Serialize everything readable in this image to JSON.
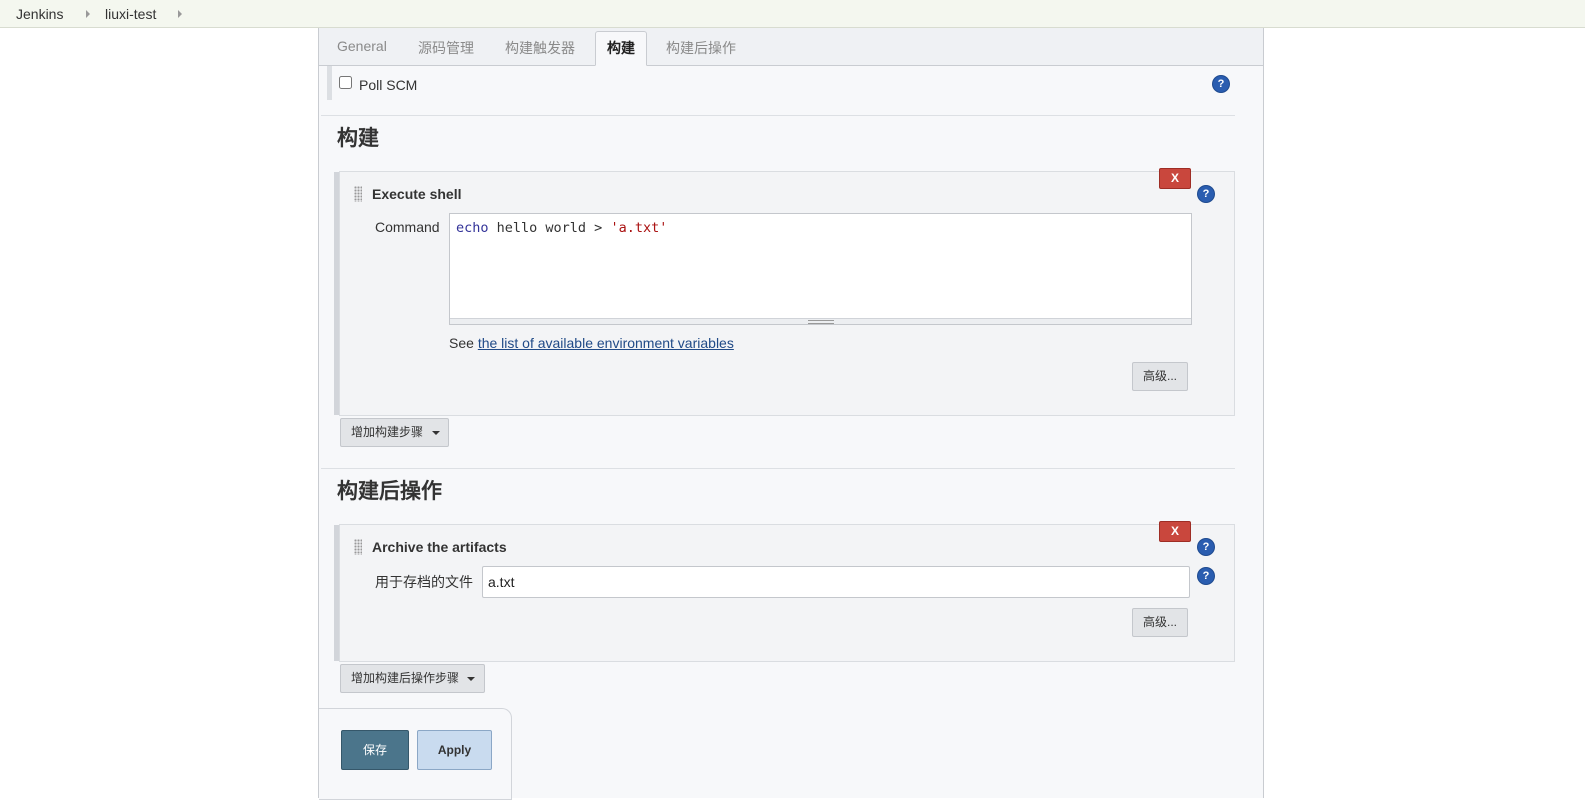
{
  "breadcrumbs": [
    "Jenkins",
    "liuxi-test"
  ],
  "tabs": [
    "General",
    "源码管理",
    "构建触发器",
    "构建",
    "构建后操作"
  ],
  "active_tab": "构建",
  "poll_scm": {
    "label": "Poll SCM",
    "checked": false
  },
  "build_section": {
    "title": "构建",
    "step": {
      "title": "Execute shell",
      "delete_label": "X",
      "command_label": "Command",
      "command": {
        "keyword": "echo",
        "rest": " hello world > ",
        "string": "'a.txt'"
      },
      "see_prefix": "See ",
      "env_link": "the list of available environment variables",
      "advanced_label": "高级..."
    },
    "add_step_label": "增加构建步骤"
  },
  "post_build_section": {
    "title": "构建后操作",
    "step": {
      "title": "Archive the artifacts",
      "delete_label": "X",
      "files_label": "用于存档的文件",
      "files_value": "a.txt",
      "advanced_label": "高级..."
    },
    "add_step_label": "增加构建后操作步骤"
  },
  "help_glyph": "?",
  "buttons": {
    "save": "保存",
    "apply": "Apply"
  },
  "colors": {
    "delete": "#c9473d",
    "save": "#4b758b",
    "apply": "#c9dbef",
    "help": "#2a5db0",
    "breadcrumb_bg": "#f4f7ef"
  }
}
